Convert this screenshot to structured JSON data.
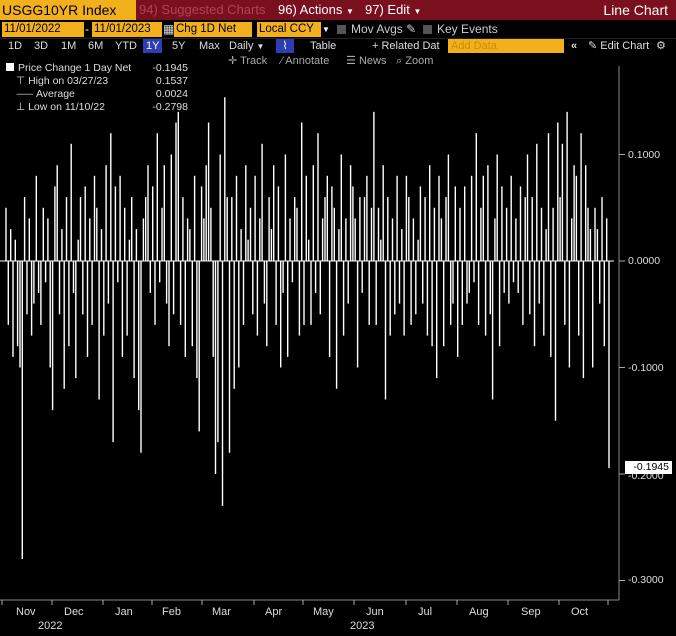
{
  "toolbar": {
    "ticker": "USGG10YR Index",
    "suggested": "94) Suggested Charts",
    "actions": "96) Actions",
    "edit": "97) Edit",
    "title": "Line Chart"
  },
  "settings": {
    "start_date": "11/01/2022",
    "end_date": "11/01/2023",
    "field": "Chg 1D Net",
    "currency": "Local CCY",
    "mov_avgs": "Mov Avgs",
    "key_events": "Key Events"
  },
  "ranges": {
    "items": [
      "1D",
      "3D",
      "1M",
      "6M",
      "YTD",
      "1Y",
      "5Y",
      "Max"
    ],
    "selected": "1Y",
    "period": "Daily",
    "table": "Table",
    "related": "+ Related Dat",
    "add_data": "Add Data",
    "edit_chart": "Edit Chart"
  },
  "tools": {
    "track": "Track",
    "annotate": "Annotate",
    "news": "News",
    "zoom": "Zoom"
  },
  "legend": {
    "series": "Price Change 1 Day Net",
    "series_value": "-0.1945",
    "high_label": "High on 03/27/23",
    "high_value": "0.1537",
    "avg_label": "Average",
    "avg_value": "0.0024",
    "low_label": "Low on 11/10/22",
    "low_value": "-0.2798"
  },
  "chart_data": {
    "type": "bar",
    "series_name": "Price Change 1 Day Net",
    "ylim": [
      -0.3,
      0.15
    ],
    "yticks": [
      "0.1000",
      "0.0000",
      "-0.1000",
      "-0.2000",
      "-0.3000"
    ],
    "last_value_label": "-0.1945",
    "months": [
      "Nov",
      "Dec",
      "Jan",
      "Feb",
      "Mar",
      "Apr",
      "May",
      "Jun",
      "Jul",
      "Aug",
      "Sep",
      "Oct"
    ],
    "years": [
      "2022",
      "2023"
    ],
    "grid": false,
    "colors": {
      "bars": "#ffffff",
      "background": "#000000"
    },
    "values": [
      0.05,
      -0.06,
      0.03,
      -0.09,
      0.02,
      -0.08,
      -0.1,
      -0.2798,
      0.06,
      -0.05,
      0.04,
      -0.07,
      -0.04,
      0.08,
      -0.03,
      -0.06,
      0.05,
      -0.02,
      0.04,
      -0.1,
      -0.14,
      0.07,
      0.09,
      -0.05,
      0.03,
      -0.12,
      0.06,
      -0.08,
      0.11,
      -0.03,
      -0.11,
      0.02,
      0.06,
      -0.05,
      0.07,
      -0.09,
      0.04,
      -0.06,
      0.08,
      0.05,
      -0.13,
      0.03,
      -0.07,
      0.09,
      -0.04,
      0.12,
      -0.17,
      0.07,
      -0.02,
      0.08,
      -0.09,
      0.05,
      -0.07,
      0.02,
      0.06,
      -0.11,
      0.03,
      -0.14,
      -0.18,
      0.04,
      0.06,
      0.09,
      -0.03,
      0.07,
      -0.06,
      0.12,
      -0.02,
      0.05,
      0.09,
      -0.04,
      -0.08,
      0.1,
      -0.05,
      0.13,
      0.14,
      -0.06,
      0.06,
      -0.09,
      0.04,
      0.03,
      -0.08,
      0.08,
      -0.11,
      -0.16,
      0.07,
      0.04,
      0.09,
      0.13,
      0.05,
      -0.09,
      -0.2,
      -0.17,
      0.1,
      -0.23,
      0.1537,
      0.06,
      -0.18,
      0.06,
      -0.12,
      0.08,
      -0.1,
      0.03,
      -0.06,
      0.09,
      0.02,
      0.05,
      -0.05,
      0.08,
      -0.07,
      0.04,
      0.11,
      -0.04,
      -0.08,
      0.06,
      0.03,
      0.09,
      -0.06,
      0.07,
      -0.1,
      -0.03,
      0.1,
      -0.09,
      0.04,
      -0.02,
      0.06,
      0.05,
      -0.07,
      0.13,
      -0.06,
      0.08,
      0.02,
      -0.06,
      0.09,
      -0.03,
      0.12,
      -0.05,
      0.04,
      0.06,
      0.08,
      -0.09,
      0.07,
      0.05,
      -0.12,
      0.03,
      0.1,
      -0.07,
      0.04,
      -0.04,
      0.09,
      0.07,
      0.04,
      -0.1,
      0.06,
      -0.03,
      0.06,
      0.08,
      -0.06,
      0.05,
      0.14,
      -0.06,
      0.05,
      0.02,
      0.09,
      -0.13,
      0.06,
      -0.07,
      0.04,
      -0.05,
      0.08,
      -0.04,
      0.03,
      -0.07,
      0.08,
      0.06,
      -0.06,
      0.04,
      -0.05,
      0.02,
      0.07,
      -0.04,
      0.06,
      -0.07,
      0.09,
      -0.08,
      0.05,
      -0.11,
      0.08,
      0.04,
      -0.08,
      0.06,
      0.1,
      -0.06,
      -0.04,
      0.07,
      -0.09,
      0.05,
      -0.06,
      0.07,
      -0.04,
      -0.03,
      0.08,
      -0.02,
      0.12,
      -0.06,
      0.05,
      0.08,
      -0.07,
      0.09,
      -0.05,
      -0.13,
      0.04,
      0.1,
      -0.08,
      0.07,
      -0.03,
      0.05,
      -0.04,
      0.08,
      -0.02,
      0.04,
      -0.03,
      0.07,
      -0.06,
      0.06,
      0.1,
      -0.05,
      0.06,
      -0.08,
      0.11,
      -0.04,
      0.05,
      -0.07,
      0.03,
      0.12,
      -0.09,
      0.05,
      -0.15,
      0.13,
      0.06,
      0.11,
      -0.06,
      0.14,
      -0.1,
      0.04,
      0.09,
      0.08,
      -0.07,
      0.12,
      -0.11,
      0.09,
      0.05,
      0.03,
      -0.1,
      0.05,
      0.03,
      -0.04,
      0.06,
      -0.08,
      0.04,
      -0.1945
    ]
  }
}
